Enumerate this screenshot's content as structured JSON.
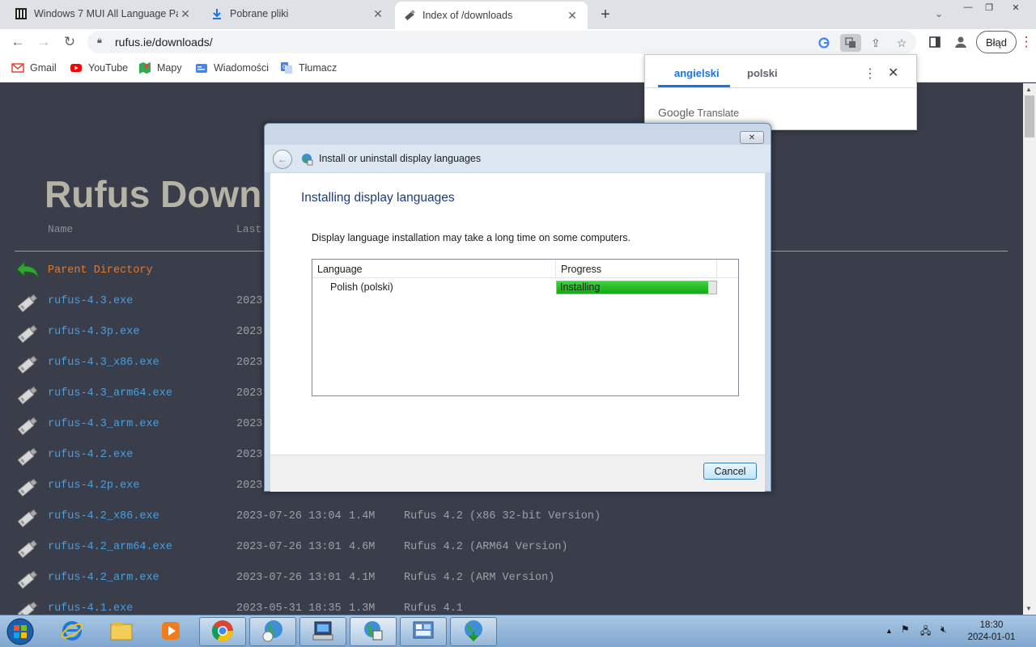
{
  "browser": {
    "tabs": [
      {
        "title": "Windows 7 MUI All Language Pa",
        "icon": "archive-icon"
      },
      {
        "title": "Pobrane pliki",
        "icon": "download-icon"
      },
      {
        "title": "Index of /downloads",
        "icon": "usb-drive-icon",
        "active": true
      }
    ],
    "url": "rufus.ie/downloads/",
    "profile_error": "Błąd",
    "bookmarks": [
      "Gmail",
      "YouTube",
      "Mapy",
      "Wiadomości",
      "Tłumacz"
    ]
  },
  "translate_popup": {
    "source_lang": "angielski",
    "target_lang": "polski",
    "brand": "Google",
    "brand_suffix": "Translate"
  },
  "page": {
    "heading": "Rufus Downl",
    "col_name": "Name",
    "col_last": "Last",
    "parent": "Parent Directory",
    "files": [
      {
        "name": "rufus-4.3.exe",
        "date": "2023",
        "size": "",
        "desc": ""
      },
      {
        "name": "rufus-4.3p.exe",
        "date": "2023",
        "size": "",
        "desc": ""
      },
      {
        "name": "rufus-4.3_x86.exe",
        "date": "2023",
        "size": "",
        "desc": ""
      },
      {
        "name": "rufus-4.3_arm64.exe",
        "date": "2023",
        "size": "",
        "desc": ""
      },
      {
        "name": "rufus-4.3_arm.exe",
        "date": "2023",
        "size": "",
        "desc": ""
      },
      {
        "name": "rufus-4.2.exe",
        "date": "2023",
        "size": "",
        "desc": ""
      },
      {
        "name": "rufus-4.2p.exe",
        "date": "2023",
        "size": "",
        "desc": ""
      },
      {
        "name": "rufus-4.2_x86.exe",
        "date": "2023-07-26 13:04",
        "size": "1.4M",
        "desc": "Rufus 4.2 (x86 32-bit Version)"
      },
      {
        "name": "rufus-4.2_arm64.exe",
        "date": "2023-07-26 13:01",
        "size": "4.6M",
        "desc": "Rufus 4.2 (ARM64 Version)"
      },
      {
        "name": "rufus-4.2_arm.exe",
        "date": "2023-07-26 13:01",
        "size": "4.1M",
        "desc": "Rufus 4.2 (ARM Version)"
      },
      {
        "name": "rufus-4.1.exe",
        "date": "2023-05-31 18:35",
        "size": "1.3M",
        "desc": "Rufus 4.1"
      }
    ]
  },
  "dialog": {
    "nav_title": "Install or uninstall display languages",
    "heading": "Installing display languages",
    "message": "Display language installation may take a long time on some computers.",
    "col_language": "Language",
    "col_progress": "Progress",
    "language": "Polish (polski)",
    "status": "Installing",
    "progress": 0.95,
    "cancel": "Cancel"
  },
  "taskbar": {
    "time": "18:30",
    "date": "2024-01-01"
  },
  "colors": {
    "page_bg": "#3a3d4a",
    "link": "#4a9fe0",
    "parent_link": "#e07a2f",
    "progress_green": "#17a817",
    "accent": "#1a73e8"
  }
}
